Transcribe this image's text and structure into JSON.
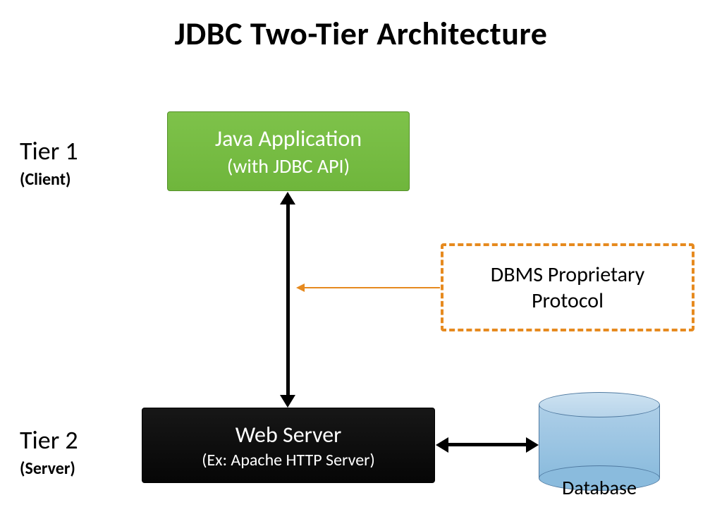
{
  "title": "JDBC Two-Tier Architecture",
  "tier1": {
    "label": "Tier 1",
    "sub": "(Client)"
  },
  "tier2": {
    "label": "Tier 2",
    "sub": "(Server)"
  },
  "java_box": {
    "line1": "Java Application",
    "line2": "(with JDBC API)"
  },
  "web_box": {
    "line1": "Web Server",
    "line2": "(Ex: Apache HTTP Server)"
  },
  "dbms_box": {
    "line1": "DBMS Proprietary",
    "line2": "Protocol"
  },
  "database": {
    "label": "Database"
  },
  "colors": {
    "java_green": "#72b93f",
    "web_black": "#0a0a0a",
    "dbms_border": "#e68a1f",
    "db_blue": "#8abbdd"
  },
  "connections": [
    {
      "from": "java_box",
      "to": "web_box",
      "style": "double-arrow-black",
      "meaning": "bidirectional communication"
    },
    {
      "from": "web_box",
      "to": "database",
      "style": "double-arrow-black",
      "meaning": "bidirectional communication"
    },
    {
      "from": "dbms_box",
      "to": "vertical_link",
      "style": "thin-arrow-orange",
      "meaning": "labels the protocol used"
    }
  ]
}
